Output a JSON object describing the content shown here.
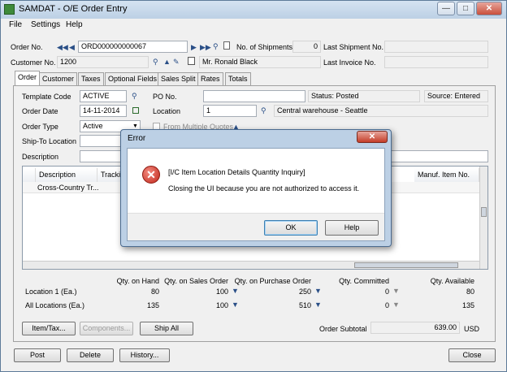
{
  "window": {
    "title": "SAMDAT - O/E Order Entry"
  },
  "menu": [
    "File",
    "Settings",
    "Help"
  ],
  "header": {
    "order_no_label": "Order No.",
    "order_no_value": "ORD000000000067",
    "shipments_label": "No. of Shipments",
    "shipments_value": "0",
    "last_shipment_label": "Last Shipment No.",
    "customer_label": "Customer No.",
    "customer_value": "1200",
    "customer_name": "Mr. Ronald Black",
    "last_invoice_label": "Last Invoice No."
  },
  "tabs": [
    "Order",
    "Customer",
    "Taxes",
    "Optional Fields",
    "Sales Split",
    "Rates",
    "Totals"
  ],
  "order": {
    "template_label": "Template Code",
    "template_value": "ACTIVE",
    "po_label": "PO No.",
    "status": "Status: Posted",
    "source": "Source: Entered",
    "date_label": "Order Date",
    "date_value": "14-11-2014",
    "location_label": "Location",
    "location_value": "1",
    "location_desc": "Central warehouse - Seattle",
    "type_label": "Order Type",
    "type_value": "Active",
    "multi_quotes": "From Multiple Quotes",
    "shipto_label": "Ship-To Location",
    "desc_label": "Description"
  },
  "grid": {
    "headers": [
      "Description",
      "Tracking",
      "Manuf. Item No."
    ],
    "rows": [
      [
        "Cross-Country Tr..."
      ]
    ]
  },
  "qty": {
    "headers": [
      "Qty. on Hand",
      "Qty. on Sales Order",
      "Qty. on Purchase Order",
      "Qty. Committed",
      "Qty. Available"
    ],
    "rows": [
      {
        "label": "Location  1 (Ea.)",
        "values": [
          "80",
          "100",
          "250",
          "0",
          "80"
        ]
      },
      {
        "label": "All Locations (Ea.)",
        "values": [
          "135",
          "100",
          "510",
          "0",
          "135"
        ]
      }
    ]
  },
  "buttons": {
    "item_tax": "Item/Tax...",
    "components": "Components...",
    "ship_all": "Ship All",
    "post": "Post",
    "delete": "Delete",
    "history": "History...",
    "close": "Close"
  },
  "subtotal": {
    "label": "Order Subtotal",
    "value": "639.00",
    "currency": "USD"
  },
  "dialog": {
    "title": "Error",
    "heading": "[I/C Item Location Details Quantity Inquiry]",
    "message": "Closing the UI because you are not authorized to access it.",
    "ok": "OK",
    "help": "Help"
  }
}
